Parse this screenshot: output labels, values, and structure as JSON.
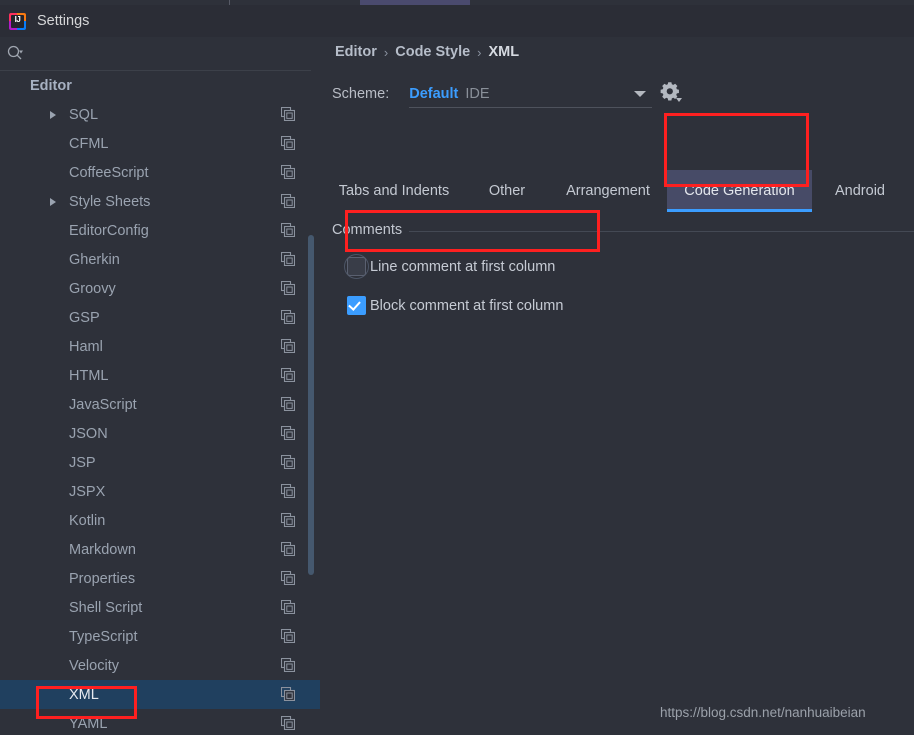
{
  "window": {
    "title": "Settings",
    "logo_icon": "intellij-idea-logo-icon"
  },
  "sidebar": {
    "search": {
      "placeholder": "",
      "value": "",
      "icon": "search-icon"
    },
    "group_label": "Editor",
    "items": [
      {
        "label": "SQL",
        "expandable": true,
        "selected": false,
        "icon": "copy-icon"
      },
      {
        "label": "CFML",
        "expandable": false,
        "selected": false,
        "icon": "copy-icon"
      },
      {
        "label": "CoffeeScript",
        "expandable": false,
        "selected": false,
        "icon": "copy-icon"
      },
      {
        "label": "Style Sheets",
        "expandable": true,
        "selected": false,
        "icon": "copy-icon"
      },
      {
        "label": "EditorConfig",
        "expandable": false,
        "selected": false,
        "icon": "copy-icon"
      },
      {
        "label": "Gherkin",
        "expandable": false,
        "selected": false,
        "icon": "copy-icon"
      },
      {
        "label": "Groovy",
        "expandable": false,
        "selected": false,
        "icon": "copy-icon"
      },
      {
        "label": "GSP",
        "expandable": false,
        "selected": false,
        "icon": "copy-icon"
      },
      {
        "label": "Haml",
        "expandable": false,
        "selected": false,
        "icon": "copy-icon"
      },
      {
        "label": "HTML",
        "expandable": false,
        "selected": false,
        "icon": "copy-icon"
      },
      {
        "label": "JavaScript",
        "expandable": false,
        "selected": false,
        "icon": "copy-icon"
      },
      {
        "label": "JSON",
        "expandable": false,
        "selected": false,
        "icon": "copy-icon"
      },
      {
        "label": "JSP",
        "expandable": false,
        "selected": false,
        "icon": "copy-icon"
      },
      {
        "label": "JSPX",
        "expandable": false,
        "selected": false,
        "icon": "copy-icon"
      },
      {
        "label": "Kotlin",
        "expandable": false,
        "selected": false,
        "icon": "copy-icon"
      },
      {
        "label": "Markdown",
        "expandable": false,
        "selected": false,
        "icon": "copy-icon"
      },
      {
        "label": "Properties",
        "expandable": false,
        "selected": false,
        "icon": "copy-icon"
      },
      {
        "label": "Shell Script",
        "expandable": false,
        "selected": false,
        "icon": "copy-icon"
      },
      {
        "label": "TypeScript",
        "expandable": false,
        "selected": false,
        "icon": "copy-icon"
      },
      {
        "label": "Velocity",
        "expandable": false,
        "selected": false,
        "icon": "copy-icon"
      },
      {
        "label": "XML",
        "expandable": false,
        "selected": true,
        "icon": "copy-icon"
      },
      {
        "label": "YAML",
        "expandable": false,
        "selected": false,
        "icon": "copy-icon"
      }
    ]
  },
  "main": {
    "breadcrumb": [
      "Editor",
      "Code Style",
      "XML"
    ],
    "breadcrumb_separator": "›",
    "scheme": {
      "label": "Scheme:",
      "value": "Default",
      "scope": "IDE",
      "gear_icon": "gear-icon"
    },
    "tabs": [
      {
        "label": "Tabs and Indents",
        "active": false
      },
      {
        "label": "Other",
        "active": false
      },
      {
        "label": "Arrangement",
        "active": false
      },
      {
        "label": "Code Generation",
        "active": true
      },
      {
        "label": "Android",
        "active": false
      }
    ],
    "comments": {
      "group_title": "Comments",
      "options": [
        {
          "label": "Line comment at first column",
          "checked": false,
          "focused": true
        },
        {
          "label": "Block comment at first column",
          "checked": true,
          "focused": false
        }
      ]
    }
  },
  "watermark": "https://blog.csdn.net/nanhuaibeian",
  "colors": {
    "accent_blue": "#3b9dff",
    "selection_blue": "#20405f",
    "annotation_red": "#fe2020",
    "tab_active_bg": "#474b67",
    "panel_bg": "#2e313a",
    "titlebar_bg": "#2b2d36"
  }
}
